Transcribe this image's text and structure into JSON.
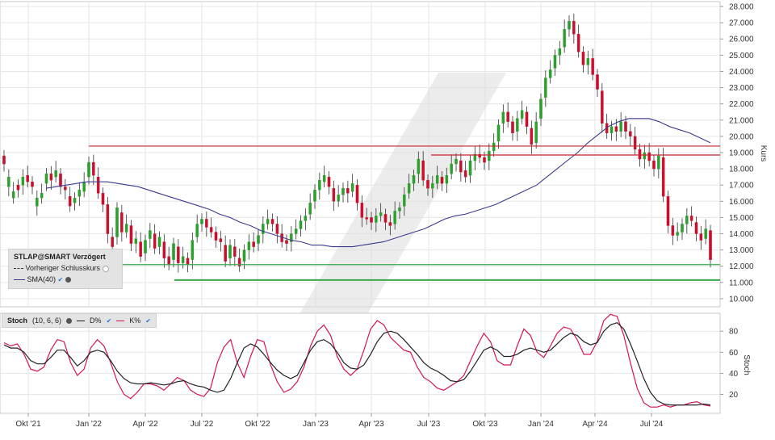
{
  "chart_data": [
    {
      "type": "candlestick",
      "ylabel": "Kurs",
      "ylim": [
        9.5,
        28.3
      ],
      "y_ticks": [
        "28.000",
        "27.000",
        "26.000",
        "25.000",
        "24.000",
        "23.000",
        "22.000",
        "21.000",
        "20.000",
        "19.000",
        "18.000",
        "17.000",
        "16.000",
        "15.000",
        "14.000",
        "13.000",
        "12.000",
        "11.000",
        "10.000"
      ],
      "y_tick_values": [
        28,
        27,
        26,
        25,
        24,
        23,
        22,
        21,
        20,
        19,
        18,
        17,
        16,
        15,
        14,
        13,
        12,
        11,
        10
      ],
      "x_ticks": [
        "Okt '21",
        "Jan '22",
        "Apr '22",
        "Jul '22",
        "Okt '22",
        "Jan '23",
        "Apr '23",
        "Jul '23",
        "Okt '23",
        "Jan '24",
        "Apr '24",
        "Jul '24"
      ],
      "close": [
        18.3,
        17.5,
        16.6,
        16.7,
        17.5,
        17.2,
        16.9,
        16.2,
        16.5,
        17.7,
        17.3,
        17.9,
        16.9,
        16.7,
        15.7,
        16.2,
        16.7,
        17.2,
        18.4,
        17.6,
        16.5,
        15.8,
        14.0,
        13.2,
        15.6,
        14.1,
        14.6,
        13.4,
        13.7,
        12.6,
        13.6,
        14.2,
        13.1,
        13.8,
        12.5,
        12.1,
        13.4,
        12.2,
        12.6,
        12.1,
        13.6,
        14.6,
        14.9,
        14.4,
        14.1,
        13.6,
        13.5,
        12.3,
        13.3,
        12.6,
        12.0,
        13.0,
        13.5,
        13.2,
        13.9,
        14.6,
        14.9,
        14.6,
        14.0,
        13.5,
        13.4,
        14.0,
        14.3,
        14.8,
        15.1,
        15.9,
        16.7,
        17.3,
        17.6,
        16.9,
        16.0,
        16.4,
        16.8,
        16.5,
        17.1,
        15.9,
        15.0,
        14.9,
        14.7,
        15.1,
        15.3,
        14.7,
        14.5,
        15.4,
        15.6,
        16.4,
        17.1,
        17.6,
        18.6,
        17.3,
        16.8,
        17.1,
        17.6,
        17.1,
        17.6,
        18.3,
        18.6,
        17.8,
        17.5,
        18.5,
        18.9,
        18.7,
        18.4,
        19.1,
        19.6,
        20.7,
        21.5,
        20.9,
        20.2,
        21.1,
        21.6,
        20.6,
        19.5,
        20.9,
        22.3,
        23.6,
        24.1,
        25.0,
        25.4,
        26.6,
        27.1,
        26.3,
        25.2,
        24.4,
        24.8,
        23.8,
        22.9,
        20.8,
        20.2,
        20.6,
        20.3,
        20.9,
        20.3,
        20.0,
        19.2,
        18.6,
        19.0,
        18.5,
        18.0,
        18.8,
        16.3,
        14.5,
        13.9,
        14.1,
        14.6,
        15.1,
        14.8,
        14.0,
        13.6,
        14.3,
        12.4
      ],
      "open_offset": [
        0.5,
        -0.6,
        -0.4,
        0.3,
        -0.5,
        0.4,
        0.3,
        -0.5,
        -0.3,
        -0.6,
        0.4,
        -0.4,
        0.8,
        0.2,
        0.6,
        -0.3,
        -0.4,
        -0.6,
        -0.9,
        0.8,
        1.0,
        0.7,
        1.8,
        0.6,
        -1.8,
        1.2,
        -0.5,
        1.1,
        -0.3,
        0.9,
        -0.8,
        -0.5,
        0.9,
        -0.6,
        1.0,
        0.5,
        -1.0,
        1.0,
        -0.4,
        0.4,
        -1.2,
        -0.8,
        -0.3,
        0.5,
        0.3,
        0.5,
        0.2,
        1.0,
        -0.8,
        0.6,
        0.5,
        -0.7,
        -0.5,
        0.3,
        -0.5,
        -0.6,
        -0.3,
        0.3,
        0.6,
        0.5,
        0.2,
        -0.5,
        -0.3,
        -0.5,
        -0.3,
        -0.7,
        -0.7,
        -0.6,
        -0.4,
        0.6,
        0.8,
        -0.4,
        -0.4,
        0.3,
        -0.5,
        1.1,
        0.9,
        0.1,
        0.3,
        -0.4,
        -0.2,
        0.5,
        0.2,
        -0.8,
        -0.2,
        -0.7,
        -0.6,
        -0.5,
        -0.9,
        1.2,
        0.5,
        -0.3,
        -0.5,
        0.4,
        -0.5,
        -0.6,
        -0.3,
        0.7,
        0.4,
        -0.9,
        -0.4,
        0.2,
        0.3,
        -0.6,
        -0.5,
        -1.0,
        -0.7,
        0.6,
        0.7,
        -0.8,
        -0.5,
        0.9,
        1.0,
        -1.3,
        -1.2,
        -1.2,
        -0.5,
        -0.8,
        -0.4,
        -1.1,
        -0.5,
        0.8,
        1.1,
        0.8,
        -0.4,
        1.0,
        0.9,
        2.0,
        0.6,
        -0.4,
        0.3,
        -0.6,
        0.6,
        0.3,
        0.8,
        0.6,
        -0.4,
        0.5,
        0.5,
        -0.8,
        2.4,
        1.8,
        0.6,
        -0.2,
        -0.5,
        -0.5,
        0.3,
        0.7,
        0.4,
        -0.6,
        1.8
      ],
      "sma40": [
        16.8,
        16.9,
        17.0,
        17.1,
        17.2,
        17.2,
        17.2,
        17.1,
        17.0,
        16.9,
        16.7,
        16.5,
        16.3,
        16.1,
        15.9,
        15.7,
        15.5,
        15.2,
        15.0,
        14.7,
        14.5,
        14.2,
        14.0,
        13.8,
        13.6,
        13.5,
        13.3,
        13.3,
        13.2,
        13.2,
        13.2,
        13.3,
        13.4,
        13.5,
        13.7,
        13.9,
        14.1,
        14.3,
        14.6,
        14.9,
        15.1,
        15.2,
        15.4,
        15.6,
        15.8,
        16.1,
        16.4,
        16.7,
        17.0,
        17.5,
        18.0,
        18.5,
        19.0,
        19.6,
        20.1,
        20.6,
        20.9,
        21.1,
        21.1,
        21.1,
        20.9,
        20.6,
        20.4,
        20.2,
        19.9,
        19.6
      ],
      "horizontal_lines": [
        {
          "value": 19.4,
          "color": "#c8232c"
        },
        {
          "value": 18.85,
          "color": "#c8232c"
        },
        {
          "value": 12.1,
          "color": "#3aa84a"
        },
        {
          "value": 11.15,
          "color": "#3aa84a"
        }
      ],
      "legend": {
        "title": "STLAP@SMART Verzögert",
        "prev_close_label": "Vorheriger Schlusskurs",
        "sma_label": "SMA(40)"
      },
      "colors": {
        "up": "#2ca02c",
        "down": "#c8102e",
        "sma": "#3b3b8f",
        "grid": "#e6e6e6"
      }
    },
    {
      "type": "line",
      "ylabel": "Stoch",
      "ylim": [
        2,
        97
      ],
      "y_ticks": [
        "80",
        "60",
        "40",
        "20"
      ],
      "y_tick_values": [
        80,
        60,
        40,
        20
      ],
      "settings_label": "Stoch",
      "params_label": "(10, 6, 6)",
      "series": [
        {
          "name": "D%",
          "color": "#222222",
          "values": [
            67,
            64,
            64,
            60,
            52,
            49,
            49,
            55,
            62,
            62,
            55,
            47,
            52,
            60,
            62,
            60,
            52,
            42,
            35,
            31,
            30,
            30,
            31,
            30,
            29,
            30,
            32,
            33,
            30,
            28,
            27,
            24,
            22,
            24,
            35,
            50,
            64,
            68,
            65,
            58,
            50,
            43,
            38,
            35,
            38,
            50,
            62,
            70,
            72,
            68,
            60,
            50,
            45,
            44,
            48,
            58,
            70,
            78,
            80,
            78,
            72,
            65,
            58,
            50,
            45,
            42,
            38,
            33,
            32,
            34,
            42,
            52,
            62,
            65,
            62,
            56,
            56,
            58,
            62,
            64,
            62,
            60,
            62,
            68,
            74,
            78,
            76,
            70,
            67,
            69,
            80,
            86,
            88,
            82,
            68,
            52,
            35,
            22,
            14,
            11,
            10,
            10,
            10,
            10,
            10,
            11,
            10
          ]
        },
        {
          "name": "K%",
          "color": "#d4145a",
          "values": [
            69,
            66,
            68,
            58,
            44,
            42,
            46,
            62,
            72,
            70,
            50,
            38,
            44,
            64,
            72,
            66,
            50,
            32,
            20,
            16,
            22,
            30,
            30,
            28,
            24,
            30,
            36,
            33,
            24,
            20,
            18,
            26,
            50,
            65,
            72,
            50,
            36,
            56,
            72,
            70,
            48,
            32,
            22,
            25,
            32,
            46,
            66,
            80,
            86,
            76,
            56,
            44,
            38,
            44,
            62,
            82,
            90,
            86,
            74,
            68,
            62,
            60,
            46,
            36,
            32,
            26,
            24,
            28,
            32,
            38,
            52,
            66,
            78,
            70,
            52,
            48,
            48,
            66,
            82,
            76,
            60,
            55,
            66,
            78,
            84,
            82,
            72,
            58,
            58,
            70,
            90,
            96,
            94,
            76,
            50,
            26,
            12,
            8,
            8,
            10,
            8,
            10,
            10,
            12,
            13,
            10,
            9
          ]
        }
      ]
    }
  ]
}
